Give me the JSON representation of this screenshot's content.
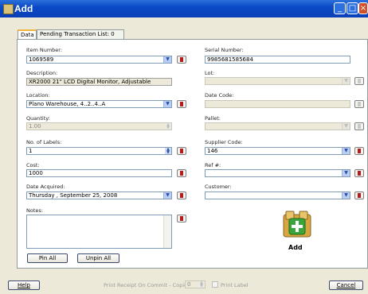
{
  "window": {
    "title": "Add"
  },
  "tabs": [
    {
      "label": "Data"
    },
    {
      "label": "Pending Transaction List: 0"
    }
  ],
  "fields": {
    "item_number": {
      "label": "Item Number:",
      "value": "1069589"
    },
    "description": {
      "label": "Description:",
      "value": "XR2000 21\" LCD Digital Monitor, Adjustable"
    },
    "location": {
      "label": "Location:",
      "value": "Plano Warehouse, 4..2..4..A"
    },
    "quantity": {
      "label": "Quantity:",
      "value": "1.00"
    },
    "no_of_labels": {
      "label": "No. of Labels:",
      "value": "1"
    },
    "cost": {
      "label": "Cost:",
      "value": "1000"
    },
    "date_acquired": {
      "label": "Date Acquired:",
      "value": "Thursday , September 25, 2008"
    },
    "notes": {
      "label": "Notes:",
      "value": ""
    },
    "serial_number": {
      "label": "Serial Number:",
      "value": "9985681585684"
    },
    "lot": {
      "label": "Lot:",
      "value": ""
    },
    "date_code": {
      "label": "Date Code:",
      "value": ""
    },
    "pallet": {
      "label": "Pallet:",
      "value": ""
    },
    "supplier_code": {
      "label": "Supplier Code:",
      "value": "146"
    },
    "ref": {
      "label": "Ref #:",
      "value": ""
    },
    "customer": {
      "label": "Customer:",
      "value": ""
    }
  },
  "buttons": {
    "pin_all": "Pin All",
    "unpin_all": "Unpin All",
    "add": "Add",
    "help": "Help",
    "cancel": "Cancel"
  },
  "footer": {
    "print_receipt": "Print Receipt On Commit - Copies:",
    "copies": "0",
    "print_label": "Print Label"
  },
  "colors": {
    "title_bar": "#0a49c6",
    "pin_active": "#b81a1a",
    "add_icon_green": "#3aa53a",
    "add_icon_gold": "#d8a640"
  }
}
